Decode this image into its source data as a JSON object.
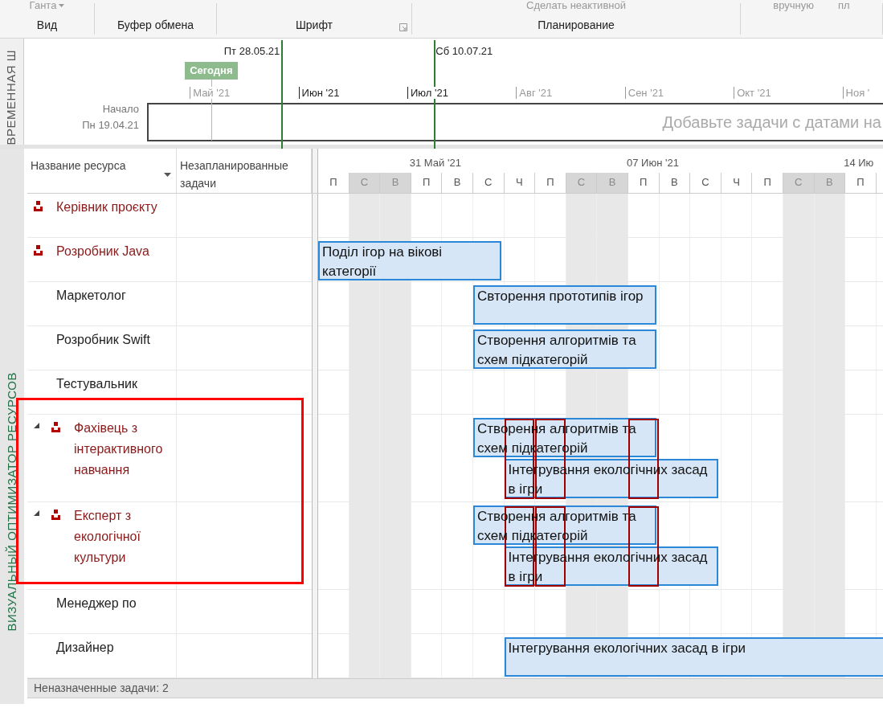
{
  "ribbon": {
    "groups": [
      {
        "label": "Вид",
        "items": [
          {
            "label": "Ганта",
            "dropdown": true
          }
        ]
      },
      {
        "label": "Буфер обмена"
      },
      {
        "label": "Шрифт",
        "launcher": true
      },
      {
        "label": "Планирование",
        "items": [
          {
            "label": "Сделать неактивной",
            "dropdown": false
          }
        ]
      },
      {
        "items": [
          {
            "label": "вручную",
            "dropdown": false
          },
          {
            "label": "пл",
            "dropdown": false
          }
        ]
      }
    ]
  },
  "timeline": {
    "pane_label": "ВРЕМЕННАЯ Ш",
    "start_label": "Начало",
    "start_date_label": "Пн 19.04.21",
    "today": {
      "label": "Сегодня"
    },
    "markers": [
      {
        "label": "Пт 28.05.21"
      },
      {
        "label": "Сб 10.07.21"
      }
    ],
    "months": [
      {
        "label": "Май '21",
        "emphasized": false
      },
      {
        "label": "Июн '21",
        "emphasized": true
      },
      {
        "label": "Июл '21",
        "emphasized": true
      },
      {
        "label": "Авг '21",
        "emphasized": false
      },
      {
        "label": "Сен '21",
        "emphasized": false
      },
      {
        "label": "Окт '21",
        "emphasized": false
      },
      {
        "label": "Ноя '",
        "emphasized": false
      }
    ],
    "empty_message": "Добавьте задачи с датами на"
  },
  "gantt": {
    "pane_label": "ВИЗУАЛЬНЫЙ ОПТИМИЗАТОР РЕСУРСОВ",
    "columns": [
      {
        "label": "Название ресурса",
        "sortable": true
      },
      {
        "label": "Незапланированные задачи",
        "sortable": false
      }
    ],
    "weeks": [
      {
        "label": "31 Май '21"
      },
      {
        "label": "07 Июн '21"
      },
      {
        "label": "14 Ию"
      }
    ],
    "days": [
      {
        "label": "П",
        "weekend": false
      },
      {
        "label": "С",
        "weekend": true
      },
      {
        "label": "В",
        "weekend": true
      },
      {
        "label": "П",
        "weekend": false
      },
      {
        "label": "В",
        "weekend": false
      },
      {
        "label": "С",
        "weekend": false
      },
      {
        "label": "Ч",
        "weekend": false
      },
      {
        "label": "П",
        "weekend": false
      },
      {
        "label": "С",
        "weekend": true
      },
      {
        "label": "В",
        "weekend": true
      },
      {
        "label": "П",
        "weekend": false
      },
      {
        "label": "В",
        "weekend": false
      },
      {
        "label": "С",
        "weekend": false
      },
      {
        "label": "Ч",
        "weekend": false
      },
      {
        "label": "П",
        "weekend": false
      },
      {
        "label": "С",
        "weekend": true
      },
      {
        "label": "В",
        "weekend": true
      },
      {
        "label": "П",
        "weekend": false
      }
    ],
    "resources": [
      {
        "name": "Керівник проєкту",
        "overallocated": true,
        "expanded": false,
        "highlighted": false
      },
      {
        "name": "Розробник Java",
        "overallocated": true,
        "expanded": false,
        "highlighted": false,
        "bars": [
          {
            "text": "Поділ ігор на вікові категорії"
          }
        ]
      },
      {
        "name": "Маркетолог",
        "overallocated": false,
        "expanded": false,
        "highlighted": false,
        "bars": [
          {
            "text": "Свторення прототипів ігор"
          }
        ]
      },
      {
        "name": "Розробник Swift",
        "overallocated": false,
        "expanded": false,
        "highlighted": false,
        "bars": [
          {
            "text": "Створення алгоритмів та схем підкатегорій"
          }
        ]
      },
      {
        "name": "Тестувальник",
        "overallocated": false,
        "expanded": false,
        "highlighted": false
      },
      {
        "name": "Фахівець з інтерактивного навчання",
        "overallocated": true,
        "expanded": true,
        "highlighted": true,
        "bars": [
          {
            "text": "Створення алгоритмів та схем підкатегорій"
          },
          {
            "text": "Інтегрування екологічних засад в ігри"
          }
        ]
      },
      {
        "name": "Експерт з екологічної культури",
        "overallocated": true,
        "expanded": true,
        "highlighted": true,
        "bars": [
          {
            "text": "Створення алгоритмів та схем підкатегорій"
          },
          {
            "text": "Інтегрування екологічних засад в ігри"
          }
        ]
      },
      {
        "name": "Менеджер по",
        "overallocated": false,
        "expanded": false,
        "highlighted": false
      },
      {
        "name": "Дизайнер",
        "overallocated": false,
        "expanded": false,
        "highlighted": false,
        "bars": [
          {
            "text": "Інтегрування екологічних засад в ігри"
          }
        ]
      }
    ],
    "footer": "Неназначенные задачи: 2"
  }
}
